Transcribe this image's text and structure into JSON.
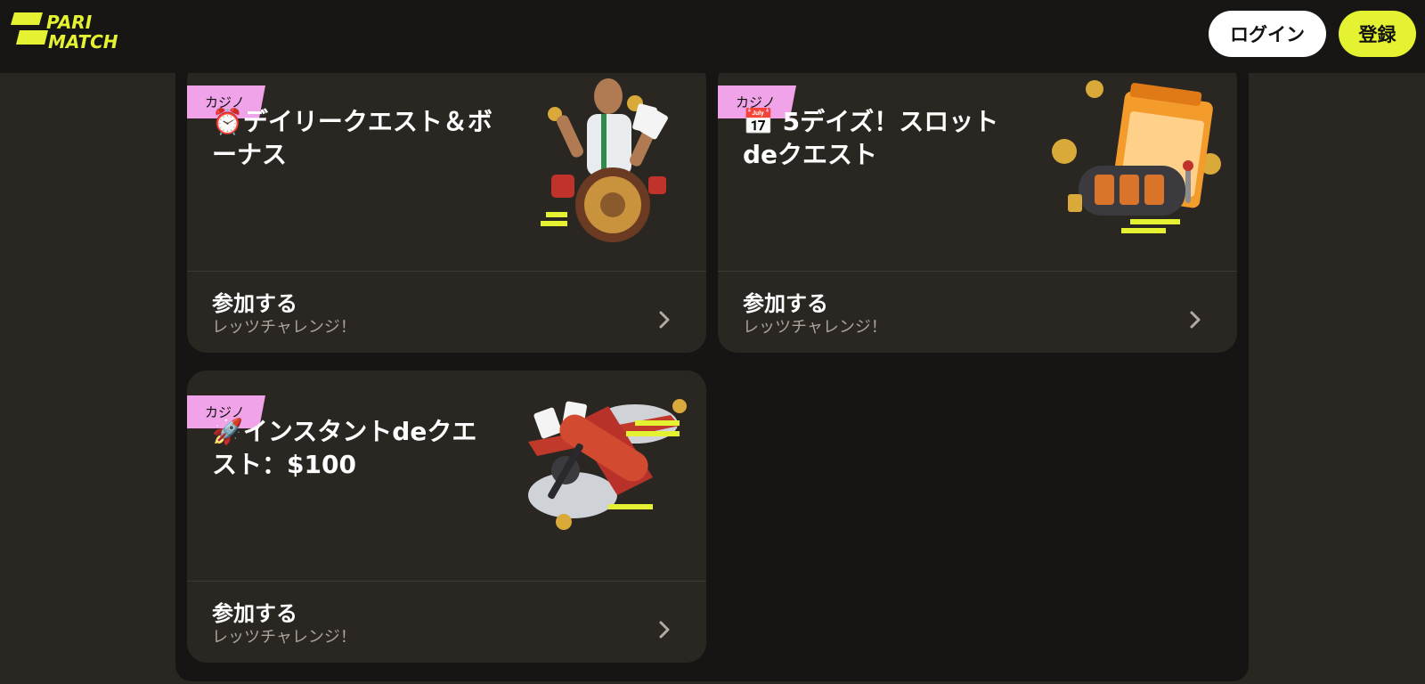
{
  "header": {
    "logo_line1": "PARI",
    "logo_line2": "MATCH",
    "login_label": "ログイン",
    "register_label": "登録"
  },
  "colors": {
    "brand_yellow": "#e5f231",
    "tag_pink": "#f0a3e8",
    "card_bg": "#2a2722"
  },
  "cards": [
    {
      "tag": "カジノ",
      "title": "⏰デイリークエスト＆ボーナス",
      "cta_label": "参加する",
      "cta_sub": "レッツチャレンジ！",
      "art_icon": "football-player-roulette-icon"
    },
    {
      "tag": "カジノ",
      "title": "📅 5デイズ！スロットdeクエスト",
      "cta_label": "参加する",
      "cta_sub": "レッツチャレンジ！",
      "art_icon": "calendar-slot-machine-icon"
    },
    {
      "tag": "カジノ",
      "title": "🚀インスタントdeクエスト：$100",
      "cta_label": "参加する",
      "cta_sub": "レッツチャレンジ！",
      "art_icon": "red-airplane-icon"
    }
  ]
}
